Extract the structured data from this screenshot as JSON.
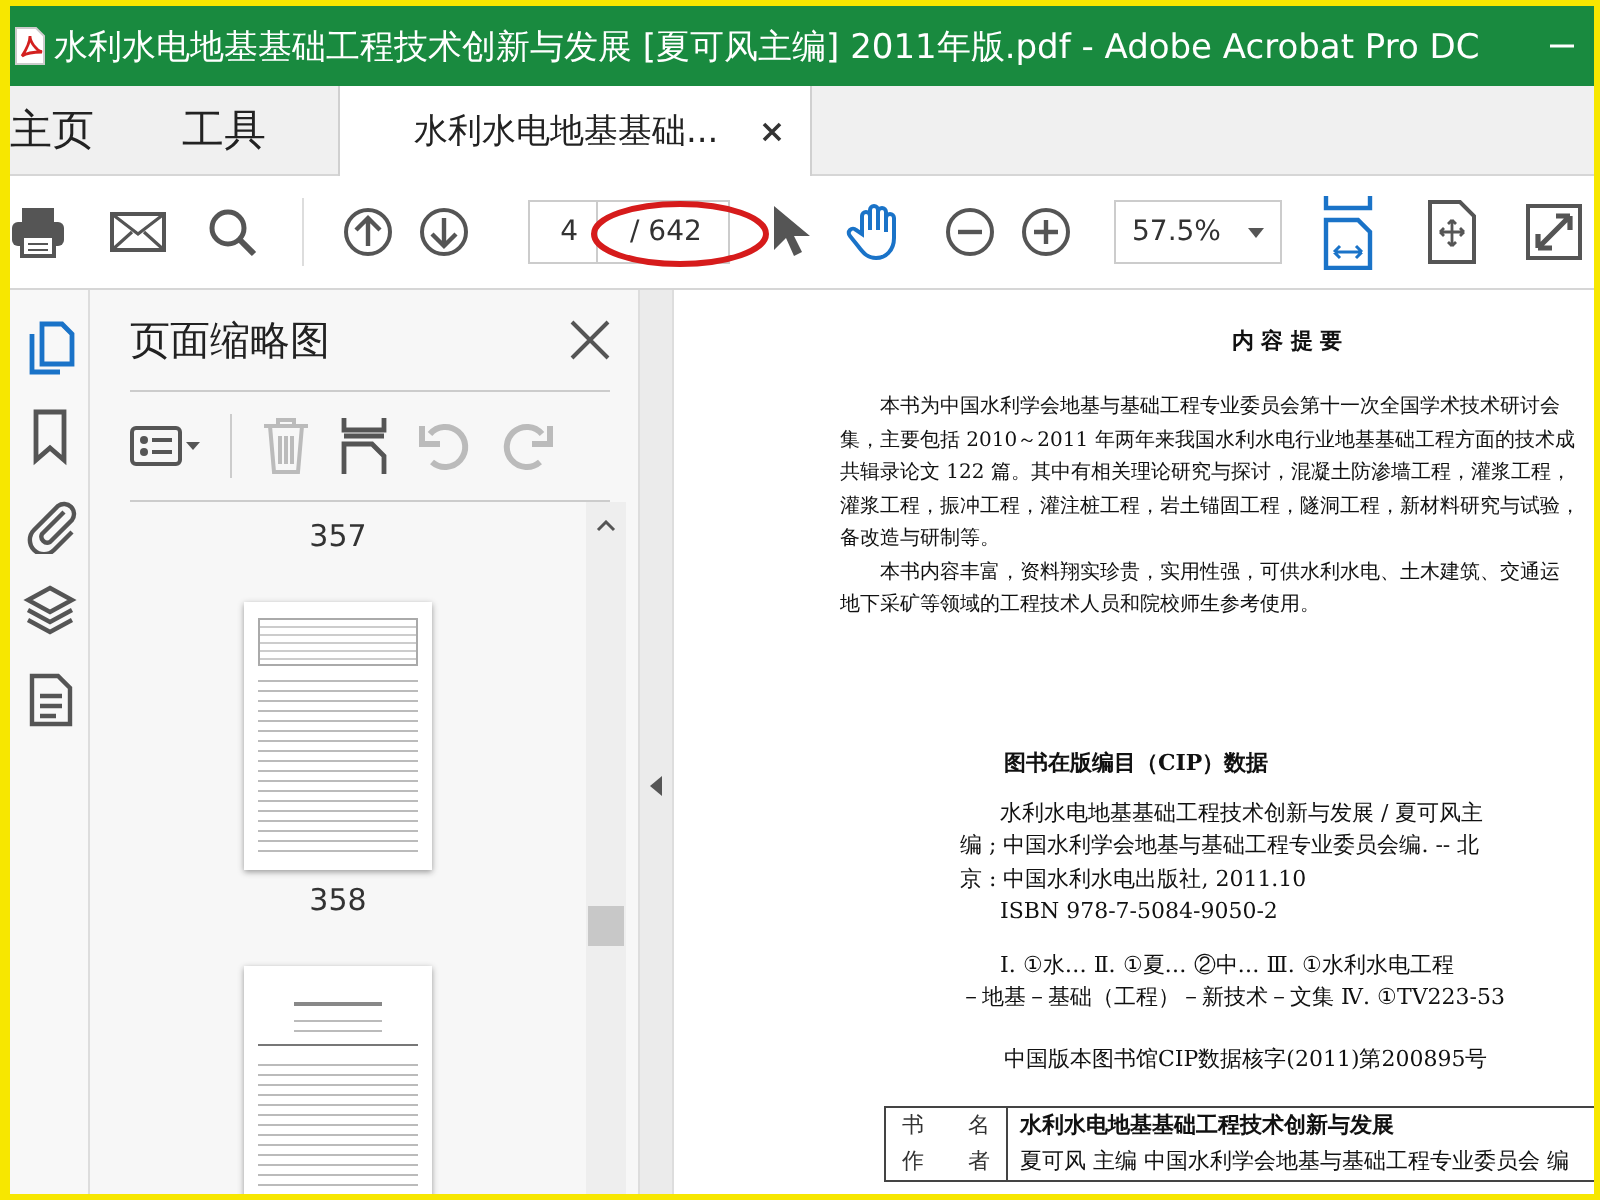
{
  "window": {
    "title": "水利水电地基基础工程技术创新与发展 [夏可风主编] 2011年版.pdf - Adobe Acrobat Pro DC"
  },
  "tabs": [
    {
      "label": "主页",
      "selected": false,
      "kind": "nav"
    },
    {
      "label": "工具",
      "selected": false,
      "kind": "nav"
    },
    {
      "label": "水利水电地基基础...",
      "selected": true,
      "kind": "document"
    }
  ],
  "toolbar": {
    "page_number": "4",
    "page_count": "/ 642",
    "zoom": "57.5%"
  },
  "side_rail": [
    {
      "kind": "pages",
      "selected": true
    },
    {
      "kind": "bookmarks",
      "selected": false
    },
    {
      "kind": "attachments",
      "selected": false
    },
    {
      "kind": "layers",
      "selected": false
    },
    {
      "kind": "content",
      "selected": false
    }
  ],
  "thumbnail_panel": {
    "title": "页面缩略图",
    "items": [
      {
        "kind": "label",
        "text": "357"
      },
      {
        "kind": "thumbnail"
      },
      {
        "kind": "label",
        "text": "358"
      },
      {
        "kind": "thumbnail"
      }
    ]
  },
  "document": {
    "heading": "内 容 提 要",
    "summary_lines": [
      {
        "text": "本书为中国水利学会地基与基础工程专业委员会第十一次全国学术技术研讨会",
        "indent": true
      },
      {
        "text": "集，主要包括 2010～2011 年两年来我国水利水电行业地基基础工程方面的技术成",
        "indent": false
      },
      {
        "text": "共辑录论文 122 篇。其中有相关理论研究与探讨，混凝土防渗墙工程，灌浆工程，",
        "indent": false
      },
      {
        "text": "灌浆工程，振冲工程，灌注桩工程，岩土锚固工程，隧洞工程，新材料研究与试验，",
        "indent": false
      },
      {
        "text": "备改造与研制等。",
        "indent": false
      },
      {
        "text": "本书内容丰富，资料翔实珍贵，实用性强，可供水利水电、土木建筑、交通运",
        "indent": true
      },
      {
        "text": "地下采矿等领域的工程技术人员和院校师生参考使用。",
        "indent": false
      }
    ],
    "cip_title": "图书在版编目（CIP）数据",
    "cip_lines": [
      {
        "text": "水利水电地基基础工程技术创新与发展 / 夏可风主",
        "indent": true
      },
      {
        "text": "编 ; 中国水利学会地基与基础工程专业委员会编. -- 北",
        "indent": false
      },
      {
        "text": "京 : 中国水利水电出版社, 2011.10",
        "indent": false
      },
      {
        "text": "ISBN 978-7-5084-9050-2",
        "indent": true
      }
    ],
    "classification_lines": [
      {
        "text": "Ⅰ. ①水… Ⅱ. ①夏… ②中… Ⅲ. ①水利水电工程",
        "indent": true
      },
      {
        "text": "－地基－基础（工程）－新技术－文集 Ⅳ. ①TV223-53",
        "indent": false
      }
    ],
    "cip_number": "中国版本图书馆CIP数据核字(2011)第200895号",
    "info_table": [
      {
        "label": "书 名",
        "value": "水利水电地基基础工程技术创新与发展",
        "bold": true
      },
      {
        "label": "作 者",
        "value": "夏可风 主编 中国水利学会地基与基础工程专业委员会 编",
        "bold": false
      }
    ]
  }
}
